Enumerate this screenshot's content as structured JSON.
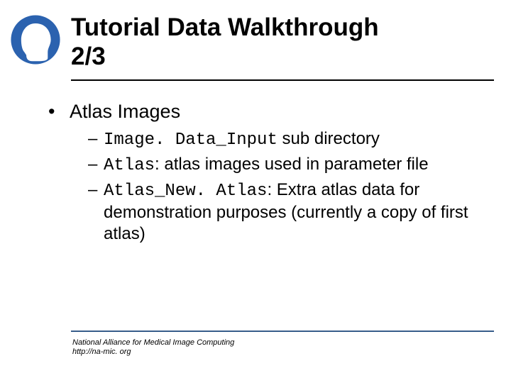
{
  "header": {
    "title_line1": "Tutorial Data Walkthrough",
    "title_line2": "2/3"
  },
  "content": {
    "level1_label": "Atlas Images",
    "items": [
      {
        "code": "Image. Data_Input",
        "text": " sub directory"
      },
      {
        "code": "Atlas",
        "text": ": atlas images used in parameter file"
      },
      {
        "code": "Atlas_New. Atlas",
        "text": ": Extra atlas data for demonstration purposes (currently a copy of first atlas)"
      }
    ]
  },
  "footer": {
    "line1": "National Alliance for Medical Image Computing",
    "line2": "http://na-mic. org"
  }
}
